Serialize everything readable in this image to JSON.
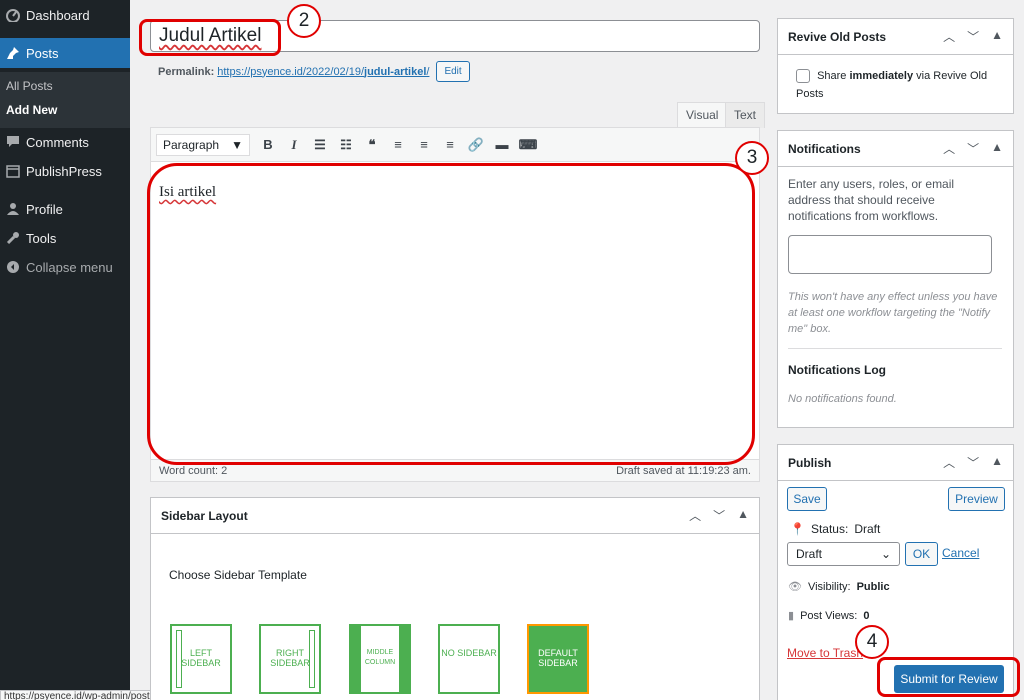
{
  "sidebar": {
    "dashboard": "Dashboard",
    "posts": "Posts",
    "all_posts": "All Posts",
    "add_new": "Add New",
    "comments": "Comments",
    "publishpress": "PublishPress",
    "profile": "Profile",
    "tools": "Tools",
    "collapse": "Collapse menu"
  },
  "statusbar": {
    "url": "https://psyence.id/wp-admin/post-new.php"
  },
  "editor": {
    "title": "Judul Artikel",
    "permalink_label": "Permalink:",
    "permalink_base": "https://psyence.id/2022/02/19/",
    "permalink_slug": "judul-artikel",
    "permalink_end": "/",
    "edit_button": "Edit",
    "tab_visual": "Visual",
    "tab_text": "Text",
    "format_select": "Paragraph",
    "content": "Isi artikel",
    "word_count": "Word count: 2",
    "draft_saved": "Draft saved at 11:19:23 am."
  },
  "sidebar_layout": {
    "title": "Sidebar Layout",
    "choose_label": "Choose Sidebar Template",
    "templates": [
      "Left Sidebar",
      "Right Sidebar",
      "Middle Column",
      "No Sidebar",
      "Default Sidebar"
    ]
  },
  "revive": {
    "title": "Revive Old Posts",
    "share_text": "Share",
    "share_bold": "immediately",
    "share_via": "via Revive Old Posts"
  },
  "notifications": {
    "title": "Notifications",
    "intro": "Enter any users, roles, or email address that should receive notifications from workflows.",
    "note": "This won't have any effect unless you have at least one workflow targeting the \"Notify me\" box.",
    "log_title": "Notifications Log",
    "log_empty": "No notifications found."
  },
  "publish": {
    "title": "Publish",
    "save": "Save",
    "preview": "Preview",
    "status_label": "Status:",
    "status_value": "Draft",
    "select_value": "Draft",
    "ok": "OK",
    "cancel": "Cancel",
    "visibility_label": "Visibility:",
    "visibility_value": "Public",
    "views_label": "Post Views:",
    "views_value": "0",
    "trash": "Move to Trash",
    "submit": "Submit for Review"
  },
  "annotations": [
    "2",
    "3",
    "4"
  ],
  "colors": {
    "accent": "#2271b1",
    "admin_bar": "#1d2327",
    "highlight": "#e00000",
    "template_green": "#4caf50"
  }
}
